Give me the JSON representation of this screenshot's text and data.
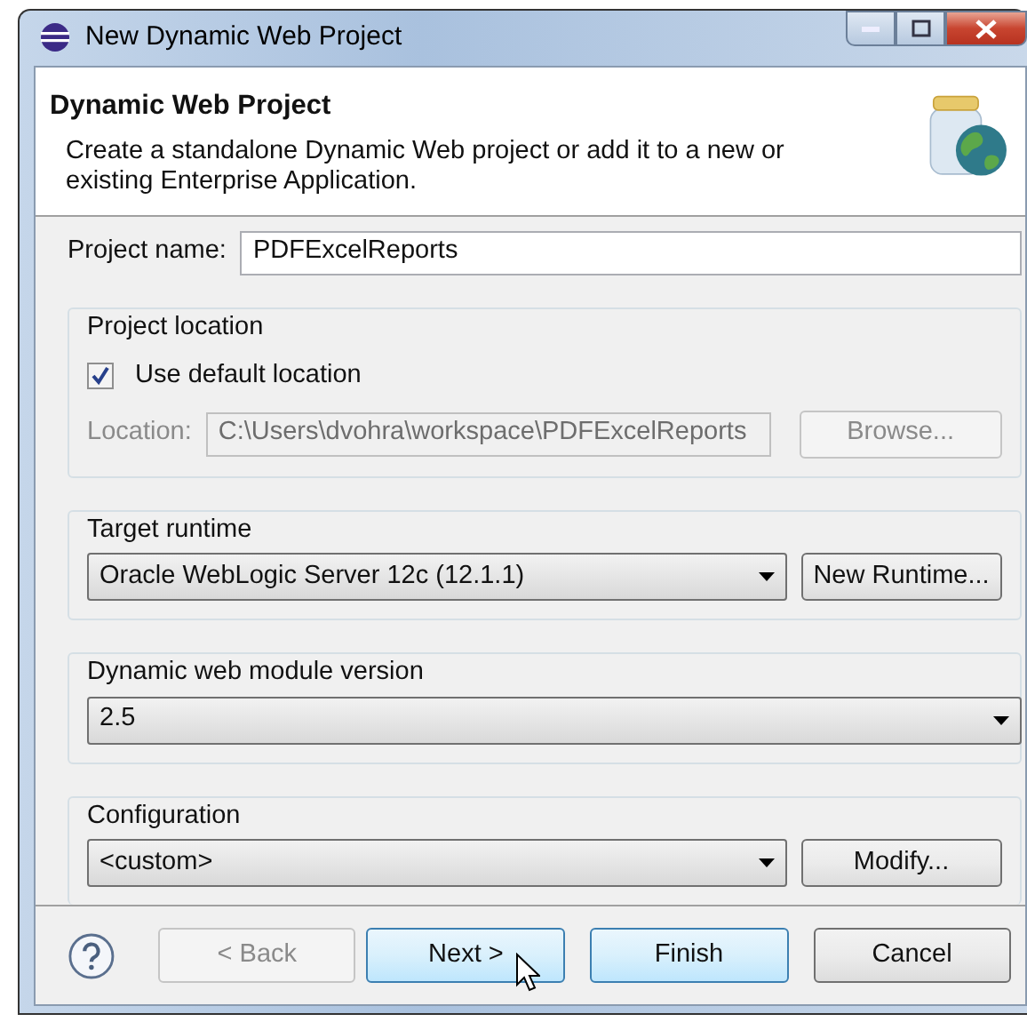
{
  "window": {
    "title": "New Dynamic Web Project"
  },
  "banner": {
    "title": "Dynamic Web Project",
    "description": "Create a standalone Dynamic Web project or add it to a new or existing Enterprise Application."
  },
  "project_name": {
    "label": "Project name:",
    "value": "PDFExcelReports"
  },
  "project_location": {
    "title": "Project location",
    "use_default": {
      "label": "Use default location",
      "checked": true
    },
    "location": {
      "label": "Location:",
      "value": "C:\\Users\\dvohra\\workspace\\PDFExcelReports",
      "disabled": true
    },
    "button": {
      "label": "Browse...",
      "disabled": true
    }
  },
  "target_runtime": {
    "title": "Target runtime",
    "value": "Oracle WebLogic Server 12c (12.1.1)",
    "button": {
      "label": "New Runtime...",
      "disabled": false
    }
  },
  "module_version": {
    "title": "Dynamic web module version",
    "value": "2.5"
  },
  "configuration": {
    "title": "Configuration",
    "value": "<custom>",
    "button": {
      "label": "Modify...",
      "disabled": false
    }
  },
  "buttons": [
    {
      "label": "< Back",
      "disabled": true,
      "highlighted": false
    },
    {
      "label": "Next >",
      "disabled": false,
      "highlighted": true
    },
    {
      "label": "Finish",
      "disabled": false,
      "highlighted": true
    },
    {
      "label": "Cancel",
      "disabled": false,
      "highlighted": false
    }
  ]
}
